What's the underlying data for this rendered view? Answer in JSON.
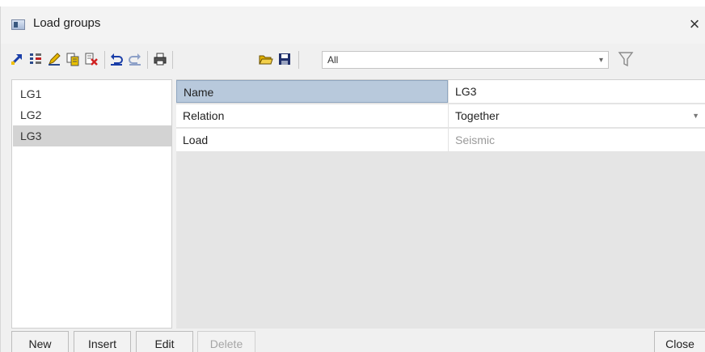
{
  "window": {
    "title": "Load groups",
    "close_glyph": "×"
  },
  "toolbar": {
    "icons": [
      "arrow-icon",
      "grid-icon",
      "pencil-icon",
      "copy-icon",
      "delete-icon",
      "undo-icon",
      "redo-icon",
      "print-icon",
      "open-icon",
      "save-icon"
    ],
    "filter_value": "All"
  },
  "list": {
    "items": [
      "LG1",
      "LG2",
      "LG3"
    ],
    "selected_index": 2
  },
  "properties": {
    "rows": [
      {
        "name": "Name",
        "value": "LG3"
      },
      {
        "name": "Relation",
        "value": "Together"
      },
      {
        "name": "Load",
        "value": "Seismic"
      }
    ]
  },
  "buttons": {
    "new": "New",
    "insert": "Insert",
    "edit": "Edit",
    "delete": "Delete",
    "close": "Close"
  },
  "colors": {
    "selected_row": "#d3d3d3",
    "active_cell": "#b8c9dc",
    "disabled_text": "#a5a5a5"
  }
}
